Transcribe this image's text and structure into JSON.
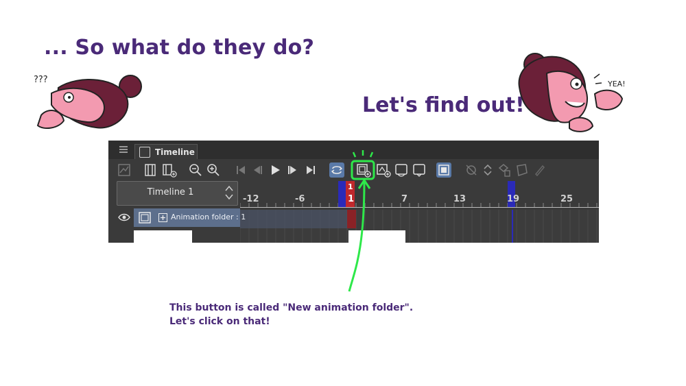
{
  "slide": {
    "heading_top": "... So what do they do?",
    "heading_right": "Let's find out!",
    "caption_line1": "This button is called \"New animation folder\".",
    "caption_line2": "Let's click on that!",
    "char_left_text": "???",
    "char_right_text": "YEA!"
  },
  "timeline": {
    "tab_label": "Timeline",
    "name": "Timeline 1",
    "layer_label": "Animation folder : 1",
    "ruler_labels": [
      "-12",
      "-6",
      "1",
      "7",
      "13",
      "19",
      "25"
    ],
    "current_frame_label": "1",
    "current_frame_marker": "1"
  },
  "colors": {
    "heading": "#4a2a78",
    "highlight_green": "#2ee84a",
    "playhead_red": "#c0282c",
    "marker_blue": "#2a2ab8",
    "character_pink": "#f39ab0",
    "character_hair": "#6b2038"
  },
  "icons": [
    "menu-icon",
    "timeline-tab-icon",
    "graph-icon",
    "frame-icon",
    "frame-add-icon",
    "zoom-out-icon",
    "zoom-in-icon",
    "first-frame-icon",
    "prev-frame-icon",
    "play-icon",
    "next-frame-icon",
    "last-frame-icon",
    "loop-icon",
    "new-animation-folder-icon",
    "new-animation-cel-icon",
    "onion-skin-icon",
    "light-table-icon",
    "sync-icon",
    "mask-icon",
    "arrows-icon",
    "delete-icon",
    "pencil-icon",
    "eye-icon",
    "expand-icon"
  ]
}
